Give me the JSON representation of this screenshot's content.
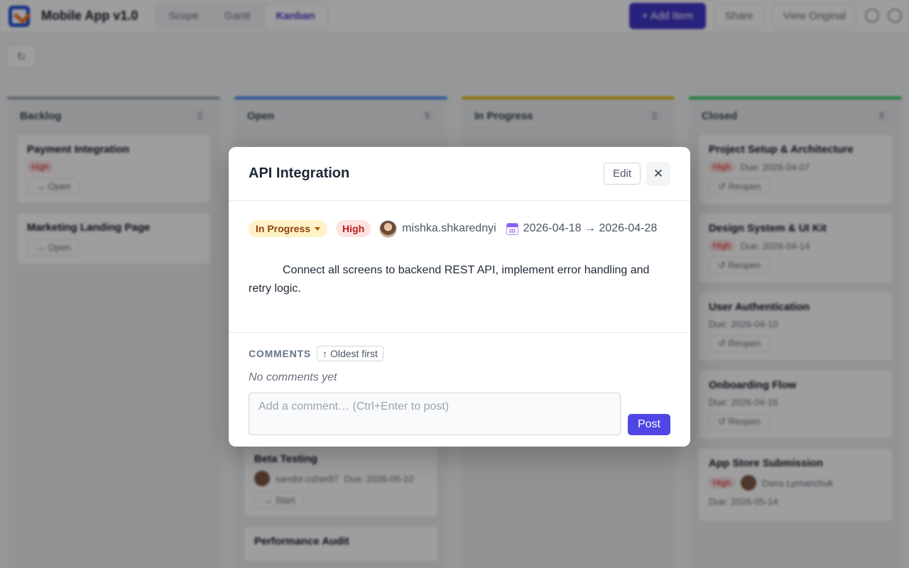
{
  "app": {
    "title": "Mobile App v1.0",
    "tabs": [
      "Scope",
      "Gantt",
      "Kanban"
    ],
    "add_label": "+ Add Item",
    "share_label": "Share",
    "view_original_label": "View Original",
    "refresh_glyph": "↻"
  },
  "board": {
    "columns": [
      {
        "title": "Backlog",
        "count": "2",
        "cards": [
          {
            "title": "Payment Integration",
            "priority": "High",
            "action": "→ Open"
          },
          {
            "title": "Marketing Landing Page",
            "action": "→ Open"
          }
        ]
      },
      {
        "title": "Open",
        "count": "5",
        "cards": [
          {
            "title": "Beta Testing",
            "assignee": "sandor.csher87",
            "due": "Due: 2026-05-10",
            "action": "→ Start"
          },
          {
            "title": "Performance Audit"
          }
        ]
      },
      {
        "title": "In Progress",
        "count": "2",
        "cards": []
      },
      {
        "title": "Closed",
        "count": "5",
        "cards": [
          {
            "title": "Project Setup & Architecture",
            "priority": "High",
            "due": "Due: 2026-04-07",
            "action": "↺ Reopen"
          },
          {
            "title": "Design System & UI Kit",
            "priority": "High",
            "due": "Due: 2026-04-14",
            "action": "↺ Reopen"
          },
          {
            "title": "User Authentication",
            "due": "Due: 2026-04-10",
            "action": "↺ Reopen"
          },
          {
            "title": "Onboarding Flow",
            "due": "Due: 2026-04-16",
            "action": "↺ Reopen"
          },
          {
            "title": "App Store Submission",
            "priority": "High",
            "assignee": "Dana Lymanchuk",
            "due": "Due: 2026-05-14"
          }
        ]
      }
    ]
  },
  "modal": {
    "title": "API Integration",
    "edit_label": "Edit",
    "close_glyph": "✕",
    "status": "In Progress",
    "priority": "High",
    "assignee": "mishka.shkarednyi",
    "dates": "2026-04-18 → 2026-04-28",
    "description": "Connect all screens to backend REST API, implement error handling and retry logic.",
    "comments": {
      "heading": "COMMENTS",
      "sort_label": "↑ Oldest first",
      "empty_text": "No comments yet",
      "input_placeholder": "Add a comment… (Ctrl+Enter to post)",
      "post_label": "Post"
    }
  },
  "colors": {
    "accent": "#4f46e5",
    "status_in_progress_bg": "#fef3c7",
    "priority_high_bg": "#fee2e2",
    "column_backlog": "#9ca3af",
    "column_open": "#3b82f6",
    "column_in_progress": "#eab308",
    "column_closed": "#22c55e"
  }
}
